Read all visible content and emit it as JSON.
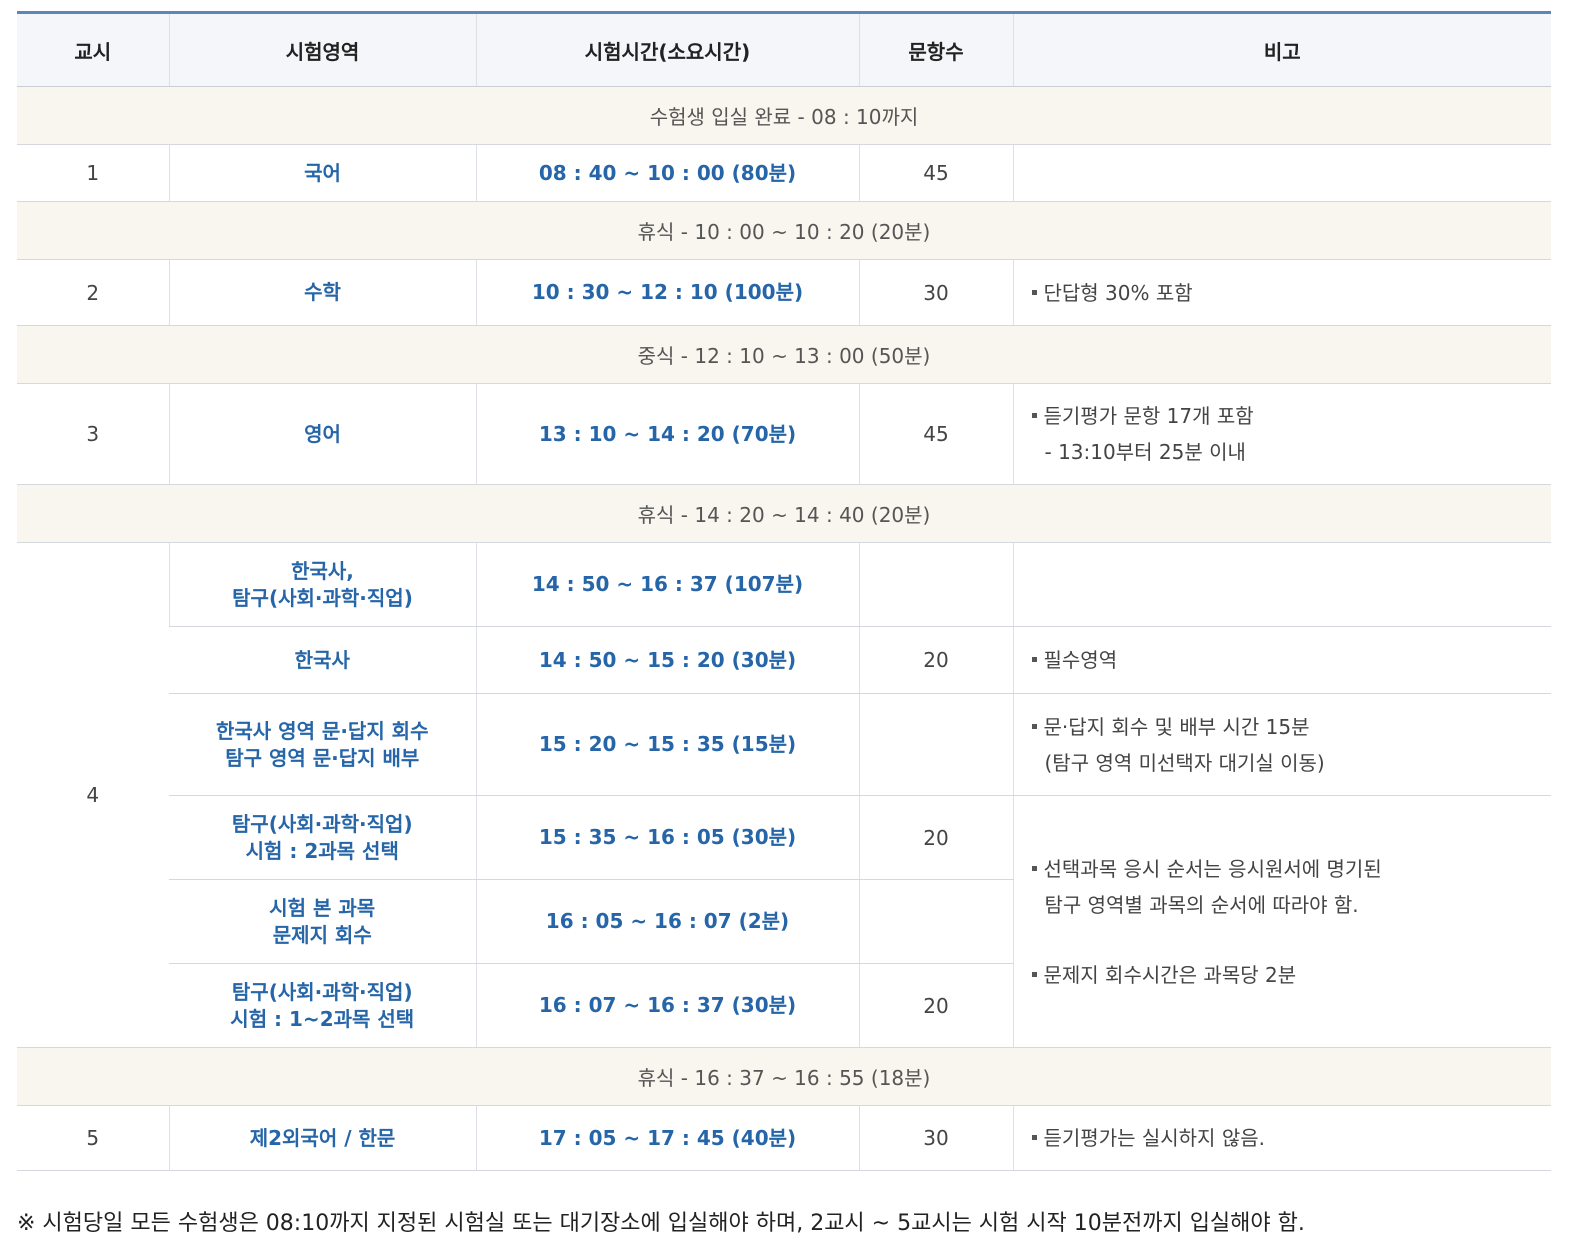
{
  "header": {
    "period": "교시",
    "area": "시험영역",
    "time": "시험시간(소요시간)",
    "count": "문항수",
    "note": "비고"
  },
  "seps": {
    "entry": "수험생 입실 완료 - 08 : 10까지",
    "break1": "휴식 - 10 : 00 ~ 10 : 20 (20분)",
    "lunch": "중식 - 12 : 10 ~ 13 : 00 (50분)",
    "break2": "휴식 - 14 : 20 ~ 14 : 40 (20분)",
    "break3": "휴식 - 16 : 37 ~ 16 : 55 (18분)"
  },
  "p1": {
    "period": "1",
    "area": "국어",
    "time": "08 : 40 ~ 10 : 00 (80분)",
    "count": "45"
  },
  "p2": {
    "period": "2",
    "area": "수학",
    "time": "10 : 30 ~ 12 : 10 (100분)",
    "count": "30",
    "note": "단답형 30% 포함"
  },
  "p3": {
    "period": "3",
    "area": "영어",
    "time": "13 : 10 ~ 14 : 20 (70분)",
    "count": "45",
    "note1": "듣기평가 문항 17개 포함",
    "note2": "- 13:10부터 25분 이내"
  },
  "p4": {
    "period": "4",
    "r1": {
      "area1": "한국사,",
      "area2": "탐구(사회·과학·직업)",
      "time": "14 : 50 ~ 16 : 37 (107분)"
    },
    "r2": {
      "area": "한국사",
      "time": "14 : 50 ~ 15 : 20 (30분)",
      "count": "20",
      "note": "필수영역"
    },
    "r3": {
      "area1": "한국사 영역 문·답지 회수",
      "area2": "탐구 영역 문·답지 배부",
      "time": "15 : 20 ~ 15 : 35 (15분)",
      "note1": "문·답지 회수 및 배부 시간 15분",
      "note2": "(탐구 영역 미선택자 대기실 이동)"
    },
    "r4": {
      "area1": "탐구(사회·과학·직업)",
      "area2": "시험 : 2과목 선택",
      "time": "15 : 35 ~ 16 : 05 (30분)",
      "count": "20",
      "note1": "선택과목 응시 순서는 응시원서에 명기된",
      "note2": "탐구 영역별 과목의 순서에 따라야 함.",
      "note3": "문제지 회수시간은 과목당 2분"
    },
    "r5": {
      "area1": "시험 본 과목",
      "area2": "문제지 회수",
      "time": "16 : 05 ~ 16 : 07 (2분)"
    },
    "r6": {
      "area1": "탐구(사회·과학·직업)",
      "area2": "시험 : 1~2과목 선택",
      "time": "16 : 07 ~ 16 : 37 (30분)",
      "count": "20"
    }
  },
  "p5": {
    "period": "5",
    "area": "제2외국어 / 한문",
    "time": "17 : 05 ~ 17 : 45 (40분)",
    "count": "30",
    "note": "듣기평가는 실시하지 않음."
  },
  "footnote": "※ 시험당일 모든 수험생은 08:10까지 지정된 시험실 또는 대기장소에 입실해야 하며, 2교시 ~ 5교시는 시험 시작 10분전까지 입실해야 함."
}
